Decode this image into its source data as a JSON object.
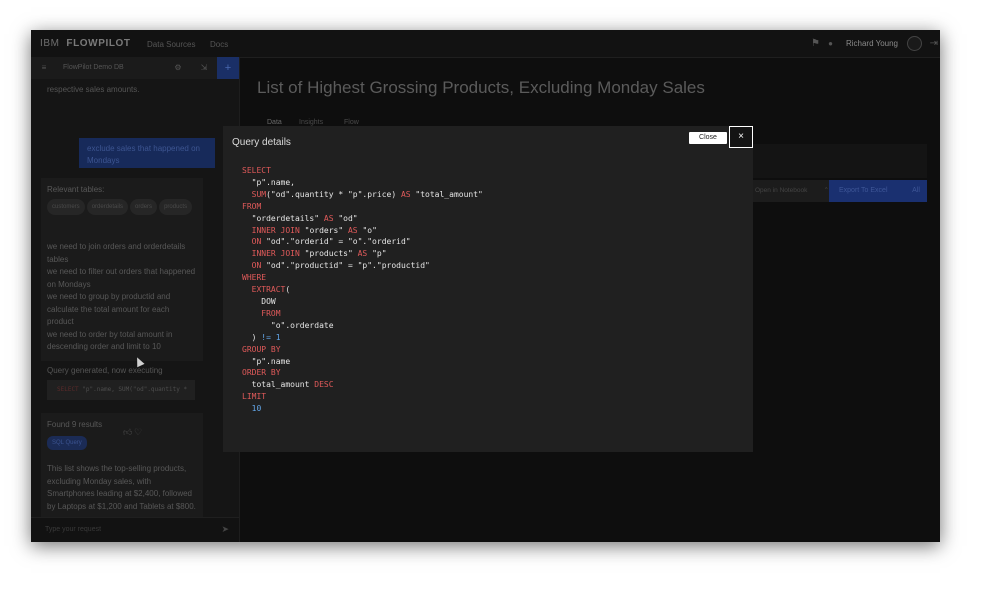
{
  "topbar": {
    "brand_ibm": "IBM",
    "brand_product": "FLOWPILOT",
    "nav": [
      "Data Sources",
      "Docs"
    ],
    "user_name": "Richard Young"
  },
  "sidebar": {
    "header_title": "FlowPilot Demo DB",
    "messages": {
      "assistant_prev_tail": "respective sales amounts.",
      "user_request": "exclude sales that happened on Mondays",
      "relevant_label": "Relevant tables:",
      "tables": [
        "customers",
        "orderdetails",
        "orders",
        "products"
      ],
      "plan": [
        "we need to join orders and orderdetails tables",
        "we need to filter out orders that happened on Mondays",
        "we need to group by productid and calculate the total amount for each product",
        "we need to order by total amount in descending order and limit to 10"
      ],
      "query_status": "Query generated, now executing",
      "query_preview_kw": "SELECT",
      "query_preview_rest": " \"p\".name, SUM(\"od\".quantity *",
      "results_label": "Found 9 results",
      "sql_badge": "SQL Query",
      "summary": "This list shows the top-selling products, excluding Monday sales, with Smartphones leading at $2,400, followed by Laptops at $1,200 and Tablets at $800."
    },
    "input_placeholder": "Type your request"
  },
  "main": {
    "title": "List of Highest Grossing Products, Excluding Monday Sales",
    "tabs": [
      "Data",
      "Insights",
      "Flow"
    ],
    "toolbar": {
      "select_label": "Open in Notebook",
      "export_label": "Export To Excel",
      "all_label": "All"
    }
  },
  "modal": {
    "title": "Query details",
    "close_tooltip": "Close",
    "close_icon": "×",
    "sql_lines": [
      [
        [
          "k",
          "SELECT"
        ]
      ],
      [
        [
          "t",
          "  \"p\".name,"
        ]
      ],
      [
        [
          "t",
          "  "
        ],
        [
          "k",
          "SUM"
        ],
        [
          "t",
          "(\"od\".quantity * \"p\".price) "
        ],
        [
          "k",
          "AS"
        ],
        [
          "t",
          " \"total_amount\""
        ]
      ],
      [
        [
          "k",
          "FROM"
        ]
      ],
      [
        [
          "t",
          "  \"orderdetails\" "
        ],
        [
          "k",
          "AS"
        ],
        [
          "t",
          " \"od\""
        ]
      ],
      [
        [
          "t",
          "  "
        ],
        [
          "k",
          "INNER JOIN"
        ],
        [
          "t",
          " \"orders\" "
        ],
        [
          "k",
          "AS"
        ],
        [
          "t",
          " \"o\""
        ]
      ],
      [
        [
          "t",
          "  "
        ],
        [
          "k",
          "ON"
        ],
        [
          "t",
          " \"od\".\"orderid\" = \"o\".\"orderid\""
        ]
      ],
      [
        [
          "t",
          "  "
        ],
        [
          "k",
          "INNER JOIN"
        ],
        [
          "t",
          " \"products\" "
        ],
        [
          "k",
          "AS"
        ],
        [
          "t",
          " \"p\""
        ]
      ],
      [
        [
          "t",
          "  "
        ],
        [
          "k",
          "ON"
        ],
        [
          "t",
          " \"od\".\"productid\" = \"p\".\"productid\""
        ]
      ],
      [
        [
          "k",
          "WHERE"
        ]
      ],
      [
        [
          "t",
          "  "
        ],
        [
          "k",
          "EXTRACT"
        ],
        [
          "t",
          "("
        ]
      ],
      [
        [
          "t",
          "    DOW"
        ]
      ],
      [
        [
          "t",
          "    "
        ],
        [
          "k",
          "FROM"
        ]
      ],
      [
        [
          "t",
          "      \"o\".orderdate"
        ]
      ],
      [
        [
          "t",
          "  ) "
        ],
        [
          "n",
          "!= 1"
        ]
      ],
      [
        [
          "k",
          "GROUP BY"
        ]
      ],
      [
        [
          "t",
          "  \"p\".name"
        ]
      ],
      [
        [
          "k",
          "ORDER BY"
        ]
      ],
      [
        [
          "t",
          "  total_amount "
        ],
        [
          "k",
          "DESC"
        ]
      ],
      [
        [
          "k",
          "LIMIT"
        ]
      ],
      [
        [
          "t",
          "  "
        ],
        [
          "n",
          "10"
        ]
      ]
    ]
  },
  "colors": {
    "sql_keyword": "#e05a5a",
    "sql_number": "#63a6e8",
    "modal_bg": "#202020",
    "page_bg": "#0e0e0e",
    "accent_blue": "#1a3070"
  }
}
